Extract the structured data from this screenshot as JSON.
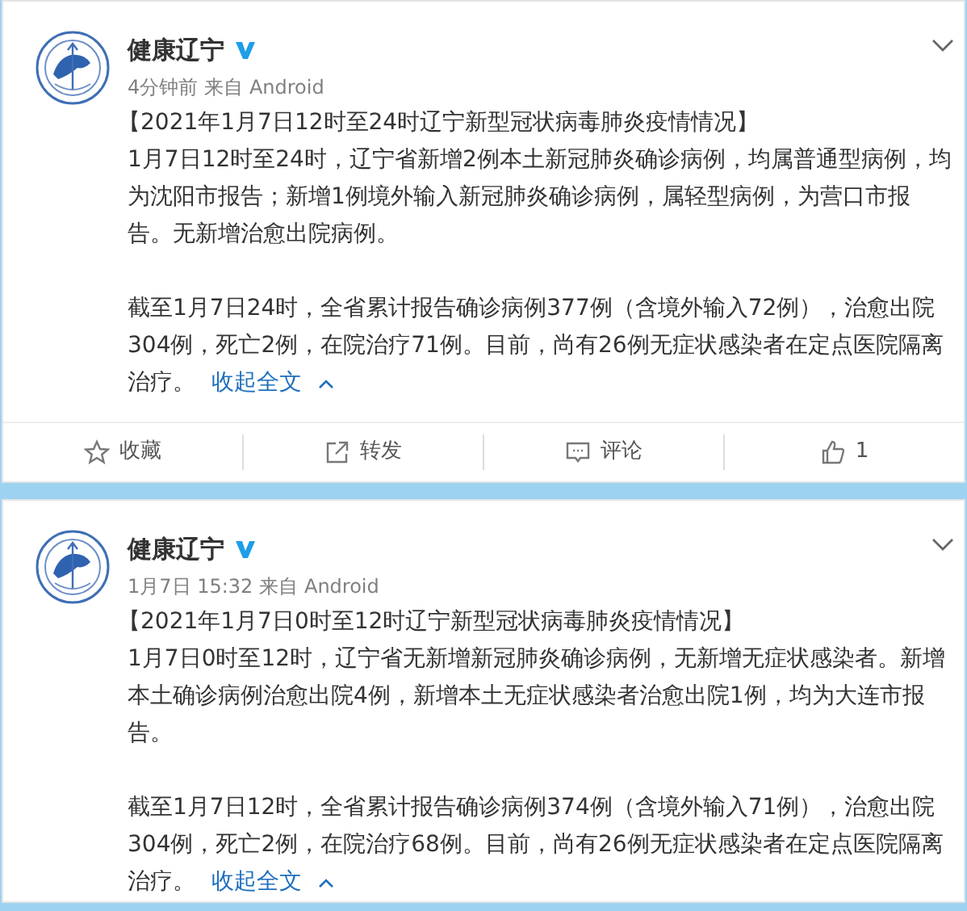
{
  "posts": [
    {
      "author": "健康辽宁",
      "verified": true,
      "time": "4分钟前",
      "source": "来自 Android",
      "title": "【2021年1月7日12时至24时辽宁新型冠状病毒肺炎疫情情况】",
      "paragraphs": [
        "1月7日12时至24时，辽宁省新增2例本土新冠肺炎确诊病例，均属普通型病例，均为沈阳市报告；新增1例境外输入新冠肺炎确诊病例，属轻型病例，为营口市报告。无新增治愈出院病例。",
        "截至1月7日24时，全省累计报告确诊病例377例（含境外输入72例），治愈出院304例，死亡2例，在院治疗71例。目前，尚有26例无症状感染者在定点医院隔离治疗。"
      ],
      "collapse_link": "收起全文",
      "actions": [
        {
          "kind": "favorite",
          "label": "收藏"
        },
        {
          "kind": "repost",
          "label": "转发"
        },
        {
          "kind": "comment",
          "label": "评论"
        },
        {
          "kind": "like",
          "label": "1"
        }
      ]
    },
    {
      "author": "健康辽宁",
      "verified": true,
      "time": "1月7日 15:32",
      "source": "来自 Android",
      "title": "【2021年1月7日0时至12时辽宁新型冠状病毒肺炎疫情情况】",
      "paragraphs": [
        "1月7日0时至12时，辽宁省无新增新冠肺炎确诊病例，无新增无症状感染者。新增本土确诊病例治愈出院4例，新增本土无症状感染者治愈出院1例，均为大连市报告。",
        "截至1月7日12时，全省累计报告确诊病例374例（含境外输入71例），治愈出院304例，死亡2例，在院治疗68例。目前，尚有26例无症状感染者在定点医院隔离治疗。"
      ],
      "collapse_link": "收起全文"
    }
  ]
}
